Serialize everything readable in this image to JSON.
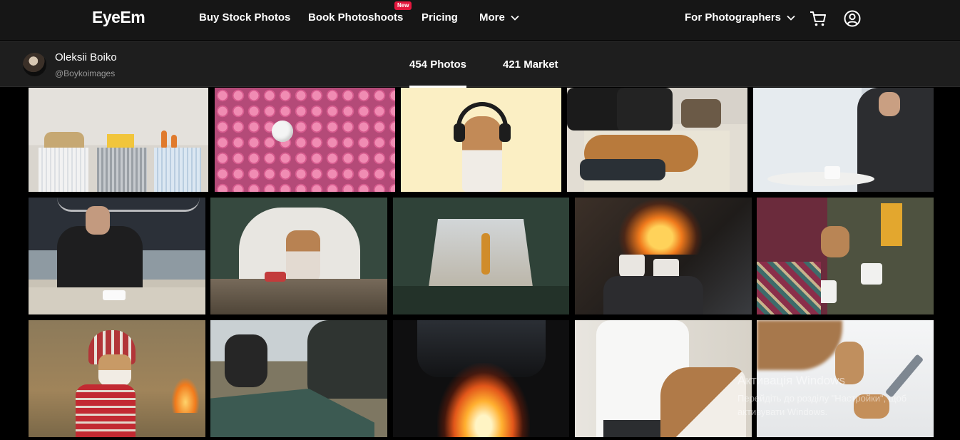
{
  "nav": {
    "logo": "EyeEm",
    "links": [
      "Buy Stock Photos",
      "Book Photoshoots",
      "Pricing",
      "More"
    ],
    "new_badge": "New",
    "for_photographers": "For Photographers",
    "cart_icon": "cart-icon",
    "account_icon": "user-circle-icon"
  },
  "profile": {
    "name": "Oleksii Boiko",
    "handle": "@Boykoimages",
    "tabs": [
      "454 Photos",
      "421 Market"
    ],
    "active_tab": "454 Photos"
  },
  "photos": [
    {
      "subject": "reusable cotton produce bags with grains and carrots"
    },
    {
      "subject": "pink pills with one white pill"
    },
    {
      "subject": "dog wearing headphones on yellow background"
    },
    {
      "subject": "dog lying on couch with blanket"
    },
    {
      "subject": "man with beard using phone at cafe table"
    },
    {
      "subject": "man with beard at table in office cafe"
    },
    {
      "subject": "dog in blanket inside green tent"
    },
    {
      "subject": "view from tent to man in forest"
    },
    {
      "subject": "hands holding cups by campfire"
    },
    {
      "subject": "people with dog holding cups outdoors"
    },
    {
      "subject": "dog in knitted hat and red sweater"
    },
    {
      "subject": "people setting up tent in forest"
    },
    {
      "subject": "campfire at night"
    },
    {
      "subject": "woman with dog on bed"
    },
    {
      "subject": "dog paws near tent peg in snow"
    }
  ],
  "watermark": {
    "line1": "Активація Windows",
    "line2": "Перейдіть до розділу \"Настройки\", щоб",
    "line3": "активувати Windows."
  },
  "colors": {
    "nav_bg": "#161616",
    "profile_bg": "#1e1e1e",
    "badge": "#e4173e"
  }
}
